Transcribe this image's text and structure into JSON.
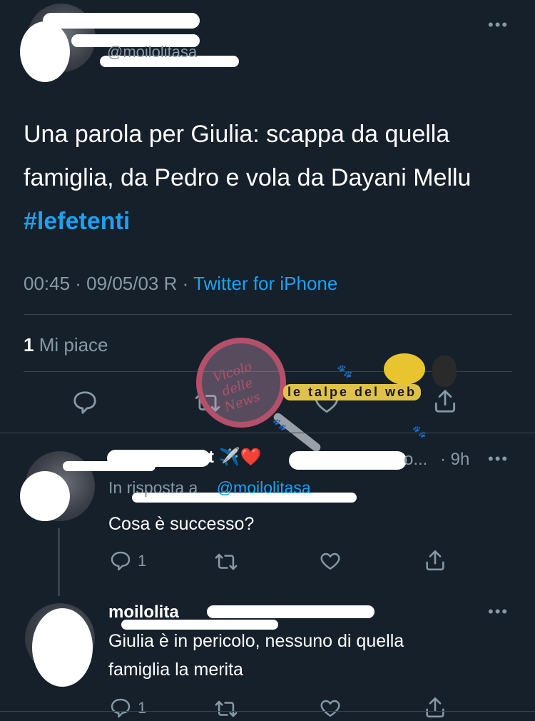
{
  "tweet": {
    "handle": "@moilolitasa",
    "text": "Una parola per Giulia: scappa da quella famiglia, da Pedro e vola da Dayani Mellu",
    "hashtag": "#lefetenti",
    "timestamp": "00:45 · 09/05/03 R ·",
    "client": "Twitter for iPhone",
    "likes_count": "1",
    "likes_label": "Mi piace"
  },
  "watermark": {
    "left_text": "Vicolo delle News",
    "right_text": "le talpe del web"
  },
  "reply1": {
    "name_suffix": "t ✈️❤️",
    "handle_fragment": "o...",
    "time": "· 9h",
    "reply_prefix": "In risposta a",
    "reply_to": "@moilolitasa",
    "text": "Cosa è successo?",
    "reply_count": "1"
  },
  "reply2": {
    "name": "moilolita",
    "text_line1": "Giulia è in pericolo, nessuno di quella",
    "text_line2": "famiglia la merita",
    "reply_count": "1"
  },
  "colors": {
    "background": "#15202b",
    "muted": "#8899a6",
    "accent": "#1da1f2",
    "divider": "#38444d"
  }
}
